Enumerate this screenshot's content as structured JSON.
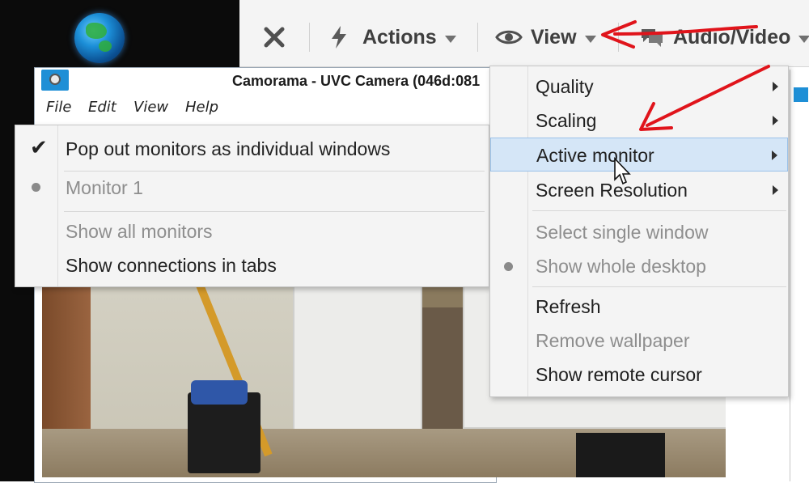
{
  "toolbar": {
    "close_icon": "close-icon",
    "actions_label": "Actions",
    "view_label": "View",
    "audio_video_label": "Audio/Video"
  },
  "camorama": {
    "title": "Camorama - UVC Camera (046d:081",
    "menu": [
      "File",
      "Edit",
      "View",
      "Help"
    ]
  },
  "left_menu": {
    "items": [
      {
        "label": "Pop out monitors as individual windows",
        "checked": true,
        "enabled": true
      },
      {
        "label": "Monitor 1",
        "radio": true,
        "enabled": false
      },
      {
        "label": "Show all monitors",
        "enabled": false
      },
      {
        "label": "Show connections in tabs",
        "enabled": true
      }
    ]
  },
  "view_menu": {
    "items": [
      {
        "label": "Quality",
        "submenu": true,
        "enabled": true
      },
      {
        "label": "Scaling",
        "submenu": true,
        "enabled": true
      },
      {
        "label": "Active monitor",
        "submenu": true,
        "enabled": true,
        "highlighted": true
      },
      {
        "label": "Screen Resolution",
        "submenu": true,
        "enabled": true
      },
      {
        "label": "Select single window",
        "enabled": false
      },
      {
        "label": "Show whole desktop",
        "enabled": false,
        "radio": true
      },
      {
        "label": "Refresh",
        "enabled": true
      },
      {
        "label": "Remove wallpaper",
        "enabled": false
      },
      {
        "label": "Show remote cursor",
        "enabled": true
      }
    ]
  },
  "colors": {
    "annotation": "#e0141b",
    "highlight": "#d5e6f7",
    "accent": "#1e8fd6"
  }
}
